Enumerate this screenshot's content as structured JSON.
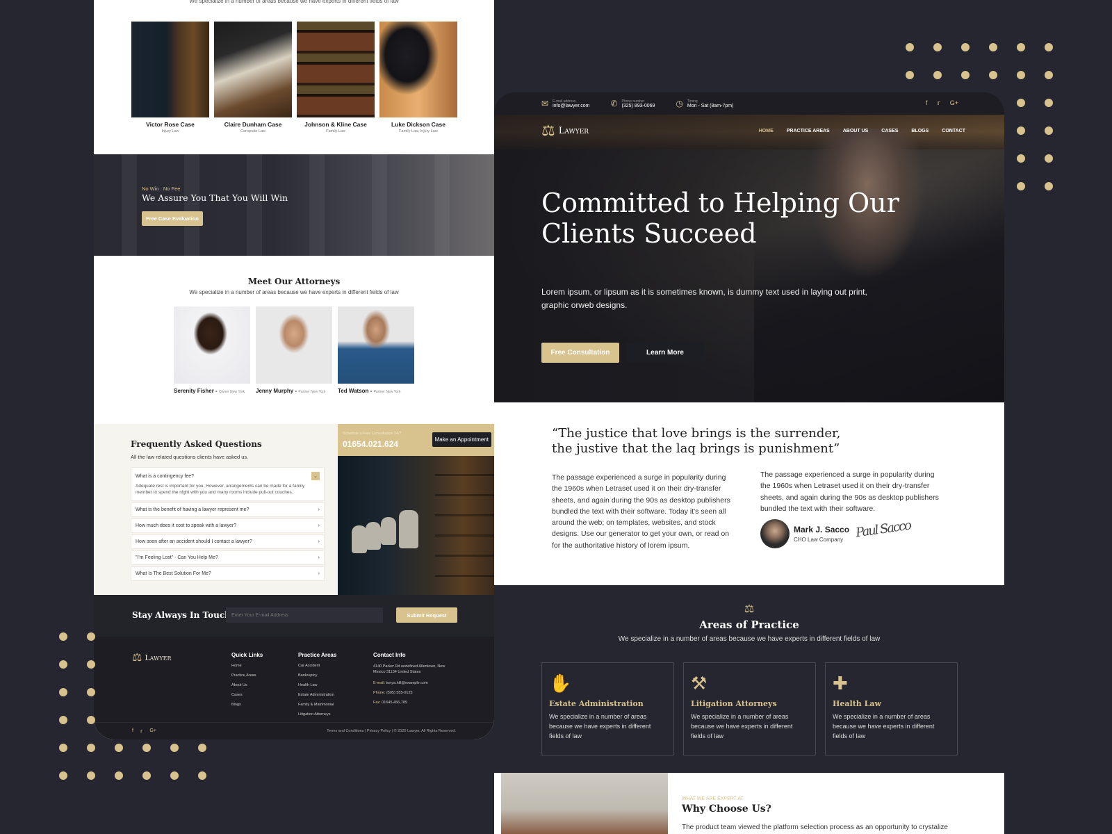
{
  "left_page": {
    "cases_subtitle": "We specialize in a number of areas because we have experts in different fields of law",
    "cases": [
      {
        "name": "Victor Rose Case",
        "category": "Injury Law"
      },
      {
        "name": "Claire Dunham Case",
        "category": "Coroprate Law"
      },
      {
        "name": "Johnson & Kline Case",
        "category": "Family Law"
      },
      {
        "name": "Luke Dickson Case",
        "category": "Family Law, Injury Law"
      }
    ],
    "promo": {
      "tag": "No Win . No Fee",
      "title": "We Assure You That You Will Win",
      "button": "Free Case Evaluation"
    },
    "attorneys": {
      "title": "Meet Our Attorneys",
      "subtitle": "We specialize in a number of areas because we have experts in different fields of law",
      "people": [
        {
          "name": "Serenity Fisher -",
          "role": "Owner New York"
        },
        {
          "name": "Jenny Murphy -",
          "role": "Partner New York"
        },
        {
          "name": "Ted Watson -",
          "role": "Partner New York"
        }
      ]
    },
    "faq": {
      "title": "Frequently Asked Questions",
      "subtitle": "All the law related questions clients have asked us.",
      "items": [
        {
          "q": "What is a contingency fee?",
          "a": "Adequate rest is important for you. However, arrangements can be made for a family member to spend the night with you and many rooms include pull-out couches.",
          "open": true
        },
        {
          "q": "What is the benefit of having a lawyer represent me?"
        },
        {
          "q": "How much does it cost to speak with a lawyer?"
        },
        {
          "q": "How soon after an accident should I contact a lawyer?"
        },
        {
          "q": "\"I'm Feeling Lost\" - Can You Help Me?"
        },
        {
          "q": "What Is The Best Solution For Me?"
        }
      ]
    },
    "appointment": {
      "label": "Schedule a Free Consultation 24/7",
      "phone": "01654.021.624",
      "button": "Make an Appointment"
    },
    "footer": {
      "newsletter_title": "Stay Always In Touch",
      "email_placeholder": "Enter Your E-mail Address",
      "submit": "Submit Request",
      "logo_text": "Lawyer",
      "quick_links": {
        "title": "Quick Links",
        "items": [
          "Home",
          "Practice Areas",
          "About Us",
          "Cases",
          "Blogs"
        ]
      },
      "practice_areas": {
        "title": "Practice Areas",
        "items": [
          "Car Accident",
          "Bankruptcy",
          "Health Law",
          "Estate Administration",
          "Family & Matrimonial",
          "Litigation Attorneys"
        ]
      },
      "contact": {
        "title": "Contact Info",
        "address": "4140 Parker Rd undefined Allentown, New Mexico 31134 United States",
        "email_label": "E-mail:",
        "email": "tonya.hill@example.com",
        "phone_label": "Phone:",
        "phone": "(505) 555-0125",
        "fax_label": "Fax:",
        "fax": "01645,456,789"
      },
      "legal": "Terms and Conditions  |  Privacy Policy  |  © 2020 Lawyer. All Rights Reserved."
    }
  },
  "right_page": {
    "topbar": {
      "email_label": "E-mail address",
      "email": "info@lawyer.com",
      "phone_label": "Phone number",
      "phone": "(325) 893-0069",
      "timing_label": "Timing",
      "timing": "Mon - Sat (8am-7pm)"
    },
    "nav": {
      "logo_text": "Lawyer",
      "links": [
        "HOME",
        "PRACTICE AREAS",
        "ABOUT US",
        "CASES",
        "BLOGS",
        "CONTACT"
      ],
      "active": "HOME"
    },
    "hero": {
      "title": "Committed to Helping Our Clients Succeed",
      "text": "Lorem ipsum, or lipsum as it is sometimes known, is dummy text used in laying out print, graphic orweb designs.",
      "primary_button": "Free Consultation",
      "secondary_button": "Learn More"
    },
    "quote": {
      "text": "“The justice that love brings is the surrender, the justive that the laq brings is punishment”",
      "col1": "The passage experienced a surge in popularity during the 1960s when Letraset used it on their dry-transfer sheets, and again during the 90s as desktop publishers bundled the text with their software. Today it's seen all around the web; on templates, websites, and stock designs. Use our generator to get your own, or read on for the authoritative history of lorem ipsum.",
      "col2": "The passage experienced a surge in popularity during the 1960s when Letraset used it on their dry-transfer sheets, and again during the 90s as desktop publishers bundled the text with their software.",
      "author_name": "Mark J. Sacco",
      "author_role": "CHO Law Company",
      "signature": "Paul Sacco"
    },
    "areas": {
      "title": "Areas of Practice",
      "subtitle": "We specialize in a number of areas because we have experts in different fields of law",
      "cards": [
        {
          "title": "Estate Administration",
          "text": "We specialize in a number of areas because we have experts in different fields of law",
          "icon": "estate-icon"
        },
        {
          "title": "Litigation Attorneys",
          "text": "We specialize in a number of areas because we have experts in different fields of law",
          "icon": "litigation-icon"
        },
        {
          "title": "Health Law",
          "text": "We specialize in a number of areas because we have experts in different fields of law",
          "icon": "health-kit-icon"
        }
      ]
    },
    "why": {
      "eyebrow": "WHAT WE ARE EXPERT AT",
      "title": "Why Choose Us?",
      "text": "The product team viewed the platform selection process as an opportunity to crystalize"
    }
  },
  "colors": {
    "accent": "#d8c28e",
    "background": "#262630",
    "dark": "#1d1d23"
  }
}
